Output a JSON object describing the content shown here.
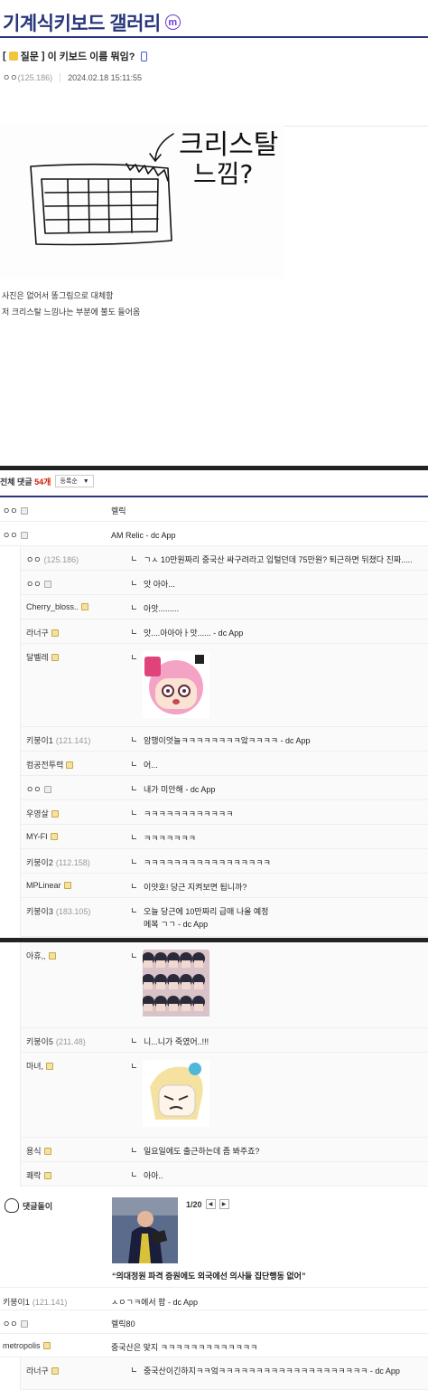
{
  "gallery": {
    "title": "기계식키보드 갤러리",
    "badge": "m"
  },
  "post": {
    "head": "[",
    "category": "질문",
    "head_close": "]",
    "title": "이 키보드 이름 뭐임?",
    "author": "ㅇㅇ",
    "author_ip": "(125.186)",
    "date": "2024.02.18 15:11:55",
    "body_lines": [
      "사진은 없어서 똥그림으로 대체함",
      "저 크리스탈 느낌나는 부분에 불도 들어옴"
    ],
    "drawing_text": [
      "크리스탈",
      "느낌?"
    ]
  },
  "comments_header": {
    "label": "전체 댓글",
    "count": "54개",
    "sort": "등록순"
  },
  "comments_a": [
    {
      "nick": "ㅇㅇ",
      "ip": "",
      "text": "렐릭",
      "reply": false,
      "icon": "gray"
    },
    {
      "nick": "ㅇㅇ",
      "ip": "",
      "text": "AM Relic - dc App",
      "reply": false,
      "icon": "gray"
    },
    {
      "nick": "ㅇㅇ",
      "ip": "(125.186)",
      "text": "ㄱㅅ 10만원짜리 중국산 싸구려라고 입털던데 75만원? 퇴근하면 뒤졌다 진짜.....",
      "reply": true,
      "icon": ""
    },
    {
      "nick": "ㅇㅇ",
      "ip": "",
      "text": "앗 아아...",
      "reply": true,
      "icon": "gray"
    },
    {
      "nick": "Cherry_bloss..",
      "ip": "",
      "text": "아앗.........",
      "reply": true,
      "icon": "gold"
    },
    {
      "nick": "라너구",
      "ip": "",
      "text": "앗....아아아ㅏ앗...... - dc App",
      "reply": true,
      "icon": "gold"
    },
    {
      "nick": "달벨레",
      "ip": "",
      "text": "",
      "reply": true,
      "icon": "gold",
      "dccon": "pink"
    },
    {
      "nick": "키붕이1",
      "ip": "(121.141)",
      "text": "암행이엇늘ㅋㅋㅋㅋㅋㅋㅋㅋ앜ㅋㅋㅋㅋ - dc App",
      "reply": true,
      "icon": ""
    },
    {
      "nick": "컴공전투력",
      "ip": "",
      "text": "어...",
      "reply": true,
      "icon": "gold"
    },
    {
      "nick": "ㅇㅇ",
      "ip": "",
      "text": "내가 미안해 - dc App",
      "reply": true,
      "icon": "gray"
    },
    {
      "nick": "우영살",
      "ip": "",
      "text": "ㅋㅋㅋㅋㅋㅋㅋㅋㅋㅋㅋㅋ",
      "reply": true,
      "icon": "gold"
    },
    {
      "nick": "MY-FI",
      "ip": "",
      "text": "ㅋㅋㅋㅋㅋㅋㅋ",
      "reply": true,
      "icon": "gold"
    },
    {
      "nick": "키붕이2",
      "ip": "(112.158)",
      "text": "ㅋㅋㅋㅋㅋㅋㅋㅋㅋㅋㅋㅋㅋㅋㅋㅋㅋ",
      "reply": true,
      "icon": ""
    },
    {
      "nick": "MPLinear",
      "ip": "",
      "text": "이얏호! 당근 지켜보면 됩니까?",
      "reply": true,
      "icon": "gold"
    },
    {
      "nick": "키붕이3",
      "ip": "(183.105)",
      "text": "오늘 당근에 10만짜리 급매 나올 예정",
      "text2": "메복 ㄱㄱ - dc App",
      "reply": true,
      "icon": ""
    }
  ],
  "comments_b": [
    {
      "nick": "아휴,,",
      "ip": "",
      "text": "",
      "reply": true,
      "icon": "gold",
      "dccon": "crowd"
    },
    {
      "nick": "키붕이5",
      "ip": "(211.48)",
      "text": "니...니가 죽였어..!!!",
      "reply": true,
      "icon": ""
    },
    {
      "nick": "마녀,",
      "ip": "",
      "text": "",
      "reply": true,
      "icon": "gold",
      "dccon": "blonde"
    },
    {
      "nick": "용식",
      "ip": "",
      "text": "일요일에도 출근하는데 좀 봐주죠?",
      "reply": true,
      "icon": "gold"
    },
    {
      "nick": "쾌락",
      "ip": "",
      "text": "아아..",
      "reply": true,
      "icon": "gold"
    }
  ],
  "ranking": {
    "label": "댓글돌이",
    "page": "1/20",
    "prev": "◀",
    "next": "▶",
    "caption": "“의대정원 파격 증원에도 외국에선 의사들 집단행동 없어”"
  },
  "comments_c": [
    {
      "nick": "키붕이1",
      "ip": "(121.141)",
      "text": "ㅅㅇㄱㅋ에서 팜 - dc App",
      "reply": false,
      "icon": ""
    },
    {
      "nick": "ㅇㅇ",
      "ip": "",
      "text": "렐릭80",
      "reply": false,
      "icon": "gray"
    },
    {
      "nick": "metropolis",
      "ip": "",
      "text": "중국산은 맞지 ㅋㅋㅋㅋㅋㅋㅋㅋㅋㅋㅋㅋㅋ",
      "reply": false,
      "icon": "gold"
    },
    {
      "nick": "라너구",
      "ip": "",
      "text": "중국산이긴하지ㅋㅋ엌ㅋㅋㅋㅋㅋㅋㅋㅋㅋㅋㅋㅋㅋㅋㅋㅋㅋㅋㅋㅋ - dc App",
      "reply": true,
      "icon": "gold"
    }
  ]
}
